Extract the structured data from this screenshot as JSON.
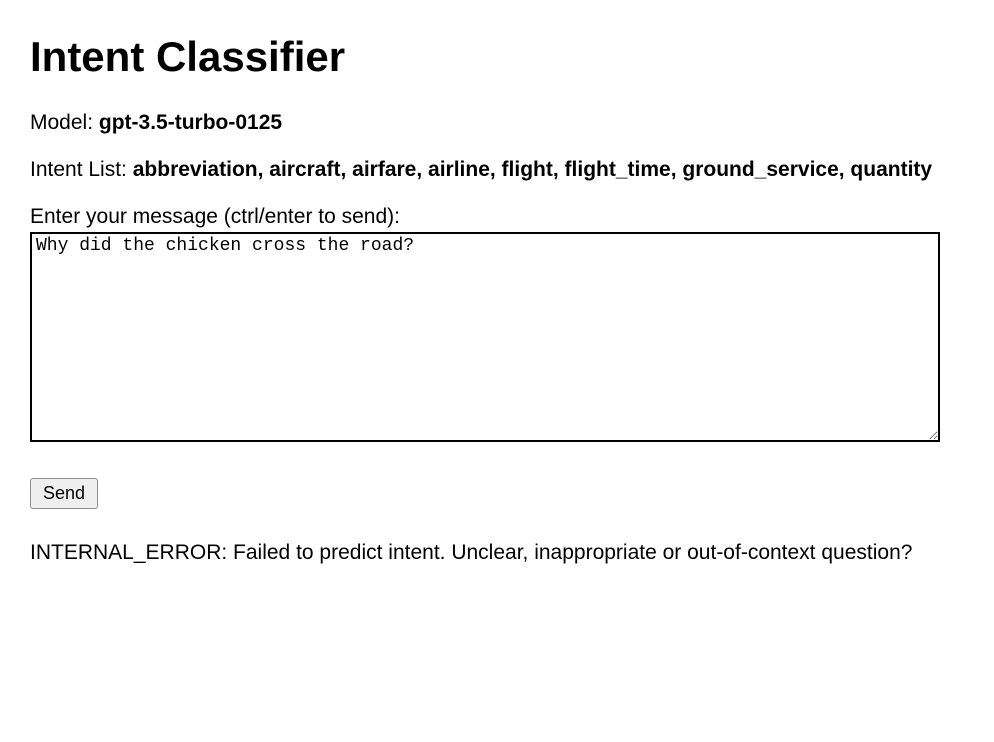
{
  "header": {
    "title": "Intent Classifier"
  },
  "model": {
    "label": "Model: ",
    "value": "gpt-3.5-turbo-0125"
  },
  "intent_list": {
    "label": "Intent List: ",
    "value": "abbreviation, aircraft, airfare, airline, flight, flight_time, ground_service, quantity"
  },
  "input": {
    "label": "Enter your message (ctrl/enter to send):",
    "value": "Why did the chicken cross the road?"
  },
  "actions": {
    "send_label": "Send"
  },
  "result": {
    "message": "INTERNAL_ERROR: Failed to predict intent. Unclear, inappropriate or out-of-context question?"
  }
}
